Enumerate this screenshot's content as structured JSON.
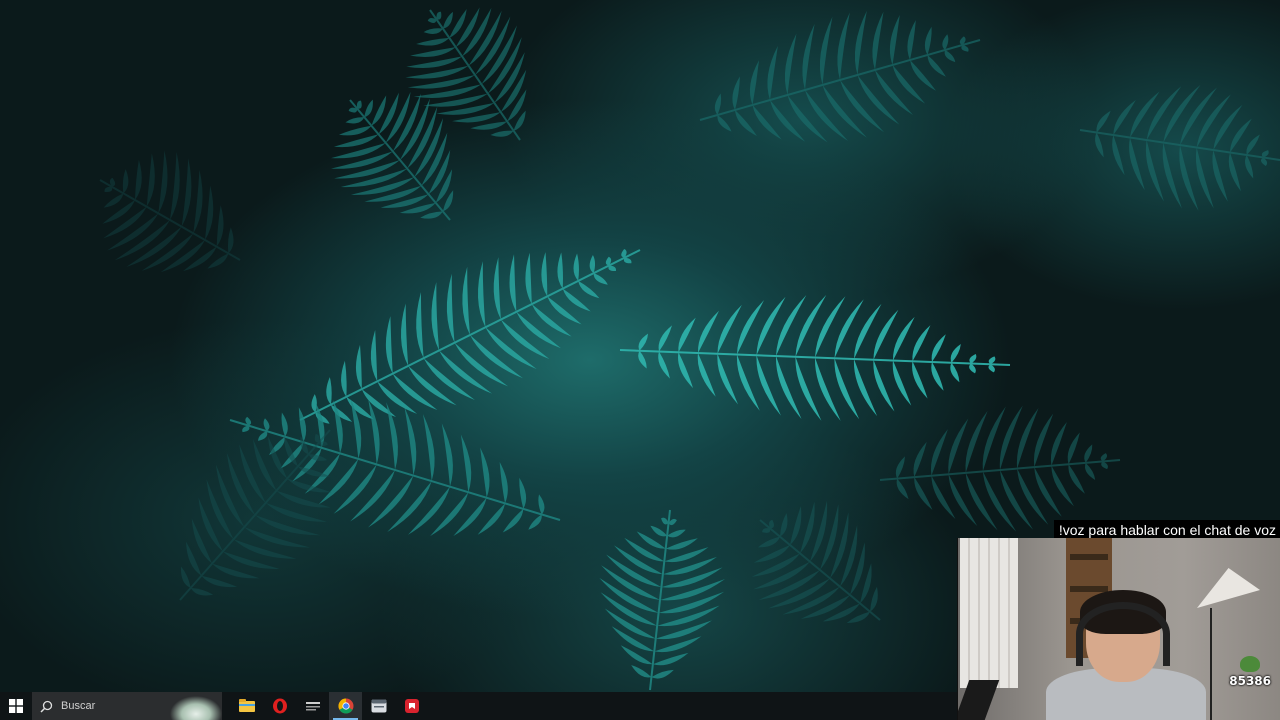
{
  "desktop": {
    "wallpaper": "fern-wallpaper"
  },
  "taskbar": {
    "start_icon": "windows-logo-icon",
    "search_placeholder": "Buscar",
    "apps": [
      {
        "name": "file-explorer-icon",
        "color": "#f4c542"
      },
      {
        "name": "opera-icon",
        "color": "#e0201f"
      },
      {
        "name": "app-icon-small",
        "color": "#cfcfcf"
      },
      {
        "name": "chrome-icon",
        "color": "#4285f4"
      },
      {
        "name": "app-window-icon",
        "color": "#d9dde2"
      },
      {
        "name": "red-app-icon",
        "color": "#d9232e"
      }
    ],
    "active_app_index": 3
  },
  "stream_overlay": {
    "command_text": "!voz para hablar con el chat de voz",
    "counter_value": "85386"
  }
}
